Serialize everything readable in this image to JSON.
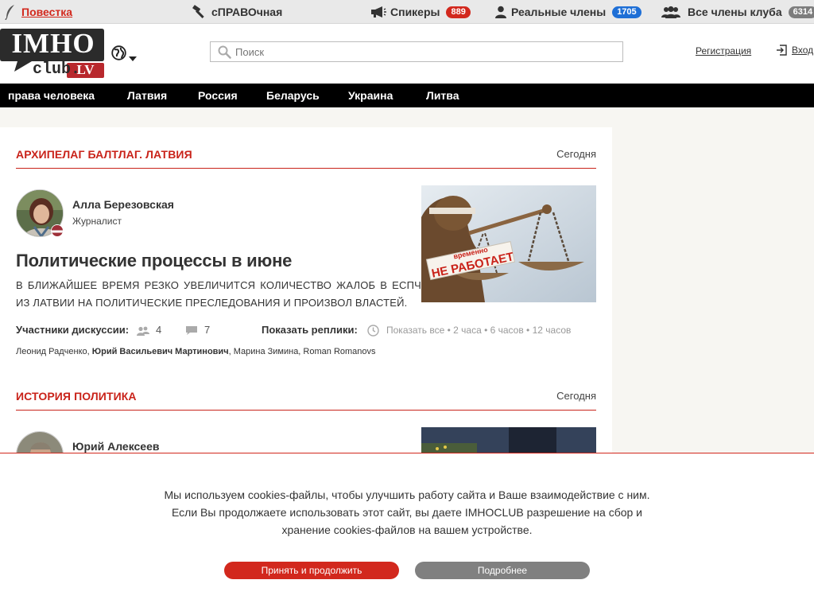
{
  "topbar": {
    "agenda": "Повестка",
    "reference": "сПРАВОчная",
    "speakers": {
      "label": "Спикеры",
      "count": "889",
      "color": "#d2281d"
    },
    "real_members": {
      "label": "Реальные члены",
      "count": "1705",
      "color": "#1e6fd6"
    },
    "all_members": {
      "label": "Все члены клуба",
      "count": "6314",
      "color": "#7d7d7d"
    }
  },
  "header": {
    "logo_top": "IMHO",
    "logo_bottom": "club.",
    "logo_domain": "LV",
    "search_placeholder": "Поиск",
    "register": "Регистрация",
    "login": "Вход"
  },
  "nav": {
    "items": [
      "права человека",
      "Латвия",
      "Россия",
      "Беларусь",
      "Украина",
      "Литва"
    ]
  },
  "articles": [
    {
      "section": "АРХИПЕЛАГ БАЛТЛАГ. ЛАТВИЯ",
      "date": "Сегодня",
      "author": "Алла Березовская",
      "role": "Журналист",
      "headline": "Политические процессы в июне",
      "lead": "В ближайшее время резко увеличится количество жалоб в ЕСПЧ из Латвии на политические преследования и произвол властей.",
      "image_caption_small": "временно",
      "image_caption": "НЕ РАБОТАЕТ",
      "participants_label": "Участники дискуссии:",
      "participants_count": "4",
      "comments_count": "7",
      "replies_label": "Показать реплики:",
      "replies_options": "Показать все • 2 часа • 6 часов • 12 часов",
      "names_before": "Леонид Радченко, ",
      "names_bold": "Юрий Васильевич Мартинович",
      "names_after": ", Марина Зимина, Roman Romanovs"
    },
    {
      "section": "ИСТОРИЯ ПОЛИТИКА",
      "date": "Сегодня",
      "author": "Юрий Алексеев"
    }
  ],
  "cookie": {
    "text": "Мы используем cookies-файлы, чтобы улучшить работу сайта и Ваше взаимодействие с ним. Если Вы продолжаете использовать этот сайт, вы даете IMHOCLUB разрешение на сбор и хранение cookies-файлов на вашем устройстве.",
    "accept": "Принять и продолжить",
    "more": "Подробнее"
  },
  "colors": {
    "accent_red": "#d2281d",
    "nav_bg": "#000000",
    "page_bg": "#f7f6f2",
    "more_button": "#808080"
  }
}
